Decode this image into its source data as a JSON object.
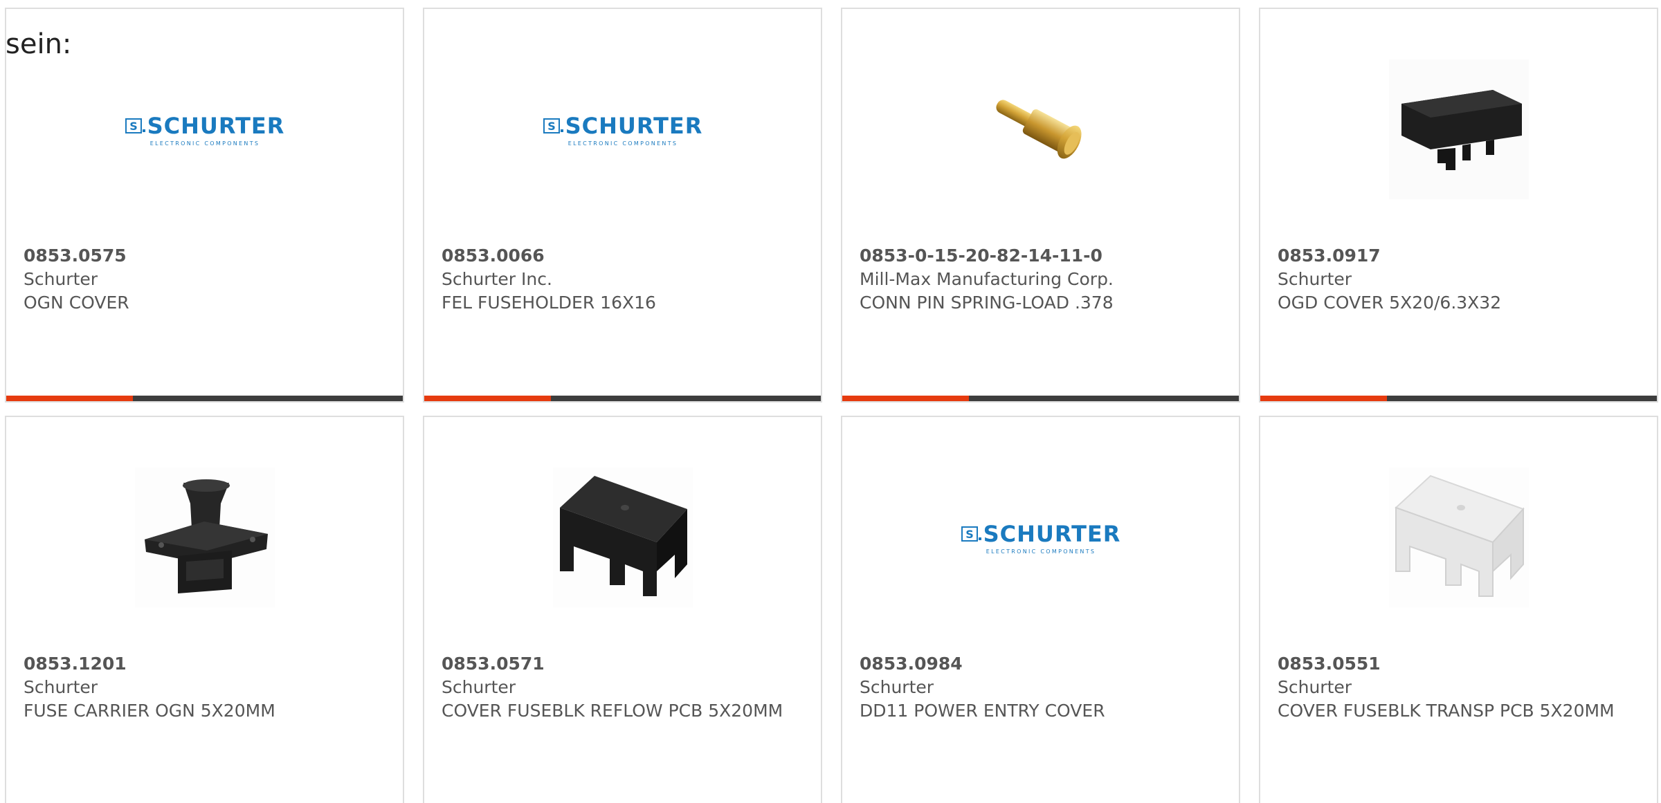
{
  "intro_text": "sein:",
  "products": [
    {
      "part_number": "0853.0575",
      "manufacturer": "Schurter",
      "description": "OGN COVER",
      "image": "schurter-logo"
    },
    {
      "part_number": "0853.0066",
      "manufacturer": "Schurter Inc.",
      "description": "FEL FUSEHOLDER 16X16",
      "image": "schurter-logo"
    },
    {
      "part_number": "0853-0-15-20-82-14-11-0",
      "manufacturer": "Mill-Max Manufacturing Corp.",
      "description": "CONN PIN SPRING-LOAD .378",
      "image": "spring-pin-photo"
    },
    {
      "part_number": "0853.0917",
      "manufacturer": "Schurter",
      "description": "OGD COVER 5X20/6.3X32",
      "image": "black-cover-photo"
    },
    {
      "part_number": "0853.1201",
      "manufacturer": "Schurter",
      "description": "FUSE CARRIER OGN 5X20MM",
      "image": "fuse-carrier-photo"
    },
    {
      "part_number": "0853.0571",
      "manufacturer": "Schurter",
      "description": "COVER FUSEBLK REFLOW PCB 5X20MM",
      "image": "black-fuseblock-cover-photo"
    },
    {
      "part_number": "0853.0984",
      "manufacturer": "Schurter",
      "description": "DD11 POWER ENTRY COVER",
      "image": "schurter-logo"
    },
    {
      "part_number": "0853.0551",
      "manufacturer": "Schurter",
      "description": "COVER FUSEBLK TRANSP PCB 5X20MM",
      "image": "transparent-fuseblock-cover-photo"
    }
  ],
  "logo": {
    "name": "SCHURTER",
    "tagline": "ELECTRONIC COMPONENTS"
  },
  "colors": {
    "accent": "#e63b0f",
    "bar": "#3d3d3d",
    "logo_blue": "#1a7abf",
    "text": "#555555",
    "border": "#dedede"
  }
}
